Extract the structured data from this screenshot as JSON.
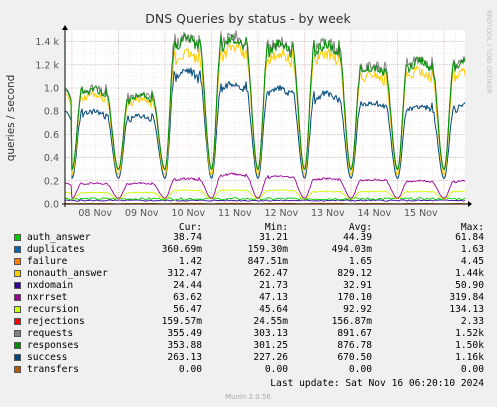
{
  "title": "DNS Queries by status - by week",
  "side_label": "RRDTOOL / TOBI OETIKER",
  "footer": "Munin 2.0.56",
  "last_update": "Last update: Sat Nov 16 06:20:10 2024",
  "legend_headers": {
    "cur": "Cur:",
    "min": "Min:",
    "avg": "Avg:",
    "max": "Max:"
  },
  "chart_data": {
    "type": "line",
    "title": "DNS Queries by status - by week",
    "ylabel": "queries / second",
    "ylim": [
      0,
      1.5
    ],
    "yticks": [
      {
        "v": 0.0,
        "label": "0.0"
      },
      {
        "v": 0.2,
        "label": "0.2"
      },
      {
        "v": 0.4,
        "label": "0.4"
      },
      {
        "v": 0.6,
        "label": "0.6"
      },
      {
        "v": 0.8,
        "label": "0.8"
      },
      {
        "v": 1.0,
        "label": "1.0"
      },
      {
        "v": 1.2,
        "label": "1.2 k"
      },
      {
        "v": 1.4,
        "label": "1.4 k"
      }
    ],
    "xticks": [
      "08 Nov",
      "09 Nov",
      "10 Nov",
      "11 Nov",
      "12 Nov",
      "13 Nov",
      "14 Nov",
      "15 Nov"
    ],
    "grid": true,
    "day_peaks": [
      {
        "requests": 1.0,
        "success": 0.8,
        "nonauth": 0.95,
        "nxrrset": 0.18,
        "recursion": 0.1,
        "failure": 0.05
      },
      {
        "requests": 0.95,
        "success": 0.76,
        "nonauth": 0.9,
        "nxrrset": 0.18,
        "recursion": 0.1,
        "failure": 0.05
      },
      {
        "requests": 1.45,
        "success": 1.15,
        "nonauth": 1.3,
        "nxrrset": 0.22,
        "recursion": 0.12,
        "failure": 0.06
      },
      {
        "requests": 1.45,
        "success": 1.05,
        "nonauth": 1.35,
        "nxrrset": 0.26,
        "recursion": 0.12,
        "failure": 0.06
      },
      {
        "requests": 1.4,
        "success": 1.0,
        "nonauth": 1.3,
        "nxrrset": 0.24,
        "recursion": 0.12,
        "failure": 0.06
      },
      {
        "requests": 1.4,
        "success": 0.95,
        "nonauth": 1.3,
        "nxrrset": 0.22,
        "recursion": 0.11,
        "failure": 0.06
      },
      {
        "requests": 1.2,
        "success": 0.88,
        "nonauth": 1.12,
        "nxrrset": 0.21,
        "recursion": 0.11,
        "failure": 0.05
      },
      {
        "requests": 1.25,
        "success": 0.85,
        "nonauth": 1.15,
        "nxrrset": 0.2,
        "recursion": 0.11,
        "failure": 0.05
      }
    ],
    "series": [
      {
        "name": "auth_answer",
        "color": "#00cc00",
        "cur": "38.74",
        "min": "31.21",
        "avg": "44.39",
        "max": "61.84"
      },
      {
        "name": "duplicates",
        "color": "#0066b3",
        "cur": "360.69m",
        "min": "159.30m",
        "avg": "494.03m",
        "max": "1.63"
      },
      {
        "name": "failure",
        "color": "#ff8000",
        "cur": "1.42",
        "min": "847.51m",
        "avg": "1.65",
        "max": "4.45"
      },
      {
        "name": "nonauth_answer",
        "color": "#ffcc00",
        "cur": "312.47",
        "min": "262.47",
        "avg": "829.12",
        "max": "1.44k"
      },
      {
        "name": "nxdomain",
        "color": "#330099",
        "cur": "24.44",
        "min": "21.73",
        "avg": "32.91",
        "max": "50.90"
      },
      {
        "name": "nxrrset",
        "color": "#990099",
        "cur": "63.62",
        "min": "47.13",
        "avg": "170.10",
        "max": "319.84"
      },
      {
        "name": "recursion",
        "color": "#ccff00",
        "cur": "56.47",
        "min": "45.64",
        "avg": "92.92",
        "max": "134.13"
      },
      {
        "name": "rejections",
        "color": "#ff0000",
        "cur": "159.57m",
        "min": "24.55m",
        "avg": "156.87m",
        "max": "2.33"
      },
      {
        "name": "requests",
        "color": "#808080",
        "cur": "355.49",
        "min": "303.13",
        "avg": "891.67",
        "max": "1.52k"
      },
      {
        "name": "responses",
        "color": "#008f00",
        "cur": "353.88",
        "min": "301.25",
        "avg": "876.78",
        "max": "1.50k"
      },
      {
        "name": "success",
        "color": "#00487d",
        "cur": "263.13",
        "min": "227.26",
        "avg": "670.50",
        "max": "1.16k"
      },
      {
        "name": "transfers",
        "color": "#b35a00",
        "cur": "0.00",
        "min": "0.00",
        "avg": "0.00",
        "max": "0.00"
      }
    ]
  }
}
